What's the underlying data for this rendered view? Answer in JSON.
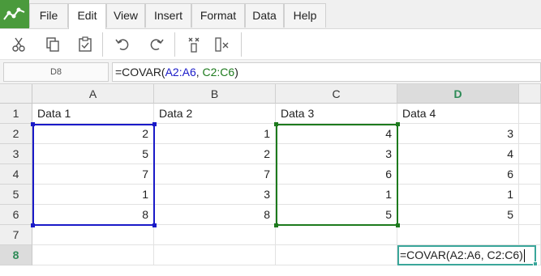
{
  "menubar": {
    "items": [
      {
        "label": "File",
        "active": false
      },
      {
        "label": "Edit",
        "active": true
      },
      {
        "label": "View",
        "active": false
      },
      {
        "label": "Insert",
        "active": false
      },
      {
        "label": "Format",
        "active": false
      },
      {
        "label": "Data",
        "active": false
      },
      {
        "label": "Help",
        "active": false
      }
    ]
  },
  "toolbar": {
    "icons": [
      "cut-icon",
      "copy-icon",
      "paste-icon",
      "undo-icon",
      "redo-icon",
      "insert-column-icon",
      "delete-column-icon"
    ]
  },
  "formula_bar": {
    "cell_ref": "D8",
    "formula_prefix": "=COVAR(",
    "ref1": "A2:A6",
    "separator": ", ",
    "ref2": "C2:C6",
    "formula_suffix": ")"
  },
  "sheet": {
    "columns": [
      "A",
      "B",
      "C",
      "D"
    ],
    "selected_column": "D",
    "rows": [
      "1",
      "2",
      "3",
      "4",
      "5",
      "6",
      "7",
      "8"
    ],
    "selected_row": "8",
    "header_row": [
      "Data 1",
      "Data 2",
      "Data 3",
      "Data 4"
    ],
    "data": [
      [
        "2",
        "1",
        "4",
        "3"
      ],
      [
        "5",
        "2",
        "3",
        "4"
      ],
      [
        "7",
        "7",
        "6",
        "6"
      ],
      [
        "1",
        "3",
        "1",
        "1"
      ],
      [
        "8",
        "8",
        "5",
        "5"
      ]
    ],
    "active_cell": "D8",
    "active_cell_text": "=COVAR(A2:A6, C2:C6)"
  },
  "colors": {
    "range1": "#1a1ac8",
    "range2": "#1d7a1d",
    "active_border": "#3aa69a",
    "logo": "#4a9a3c"
  }
}
